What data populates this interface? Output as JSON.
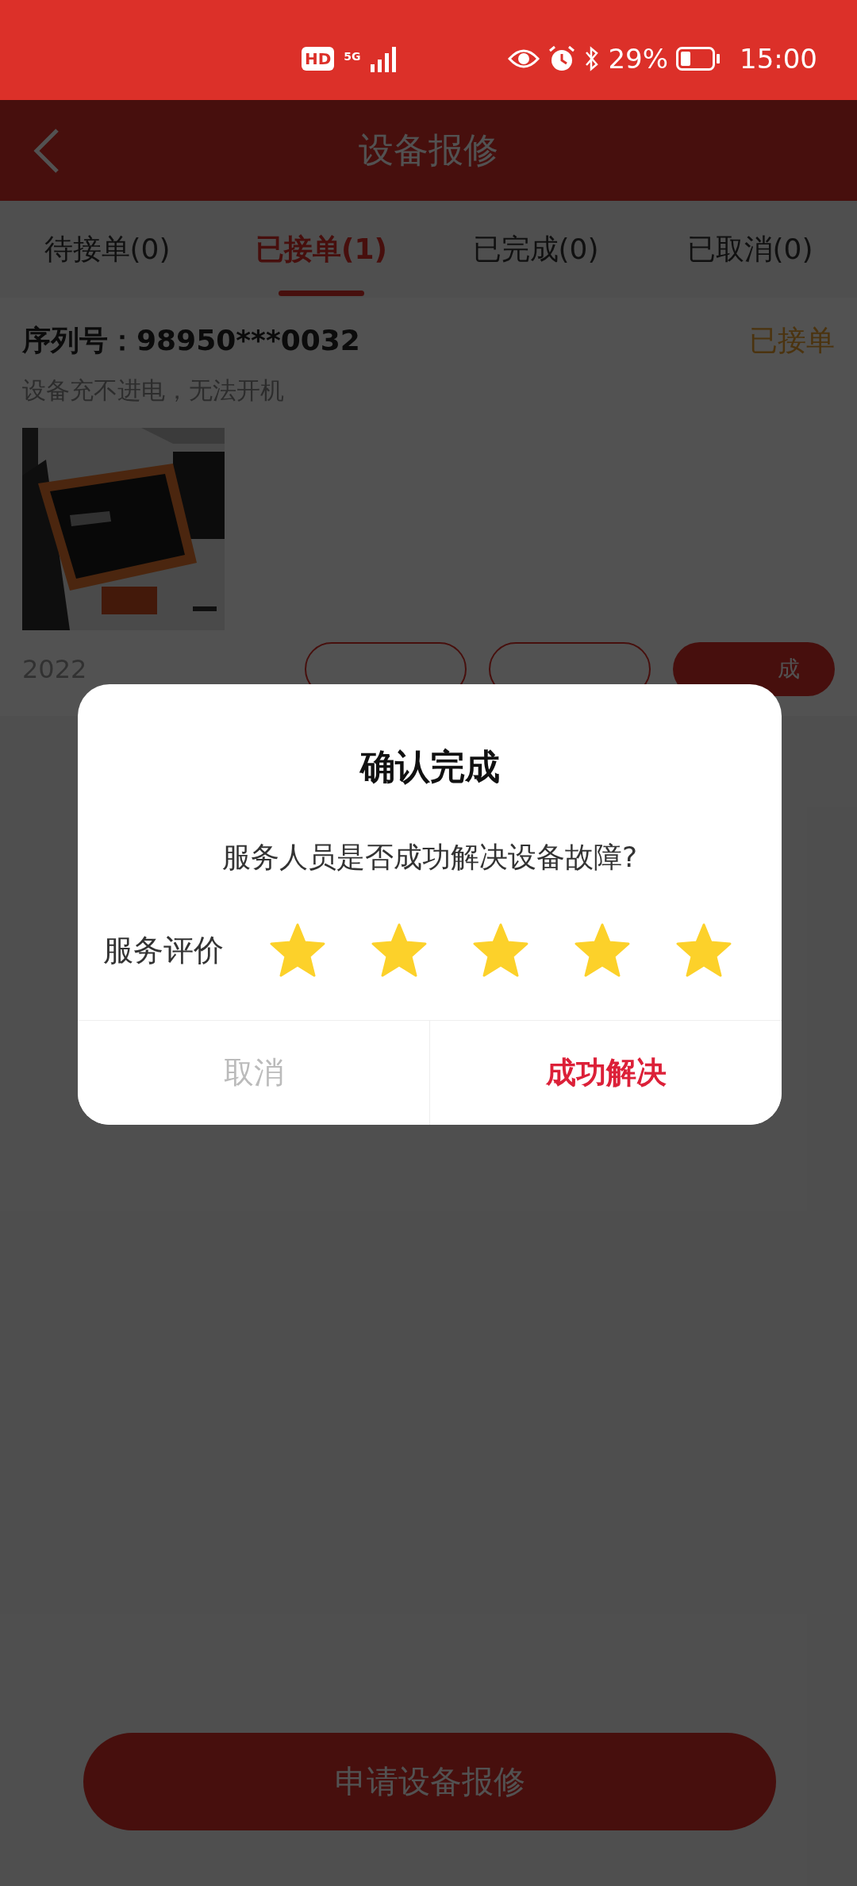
{
  "status_bar": {
    "hd": "HD",
    "network": "5G",
    "battery": "29%",
    "time": "15:00"
  },
  "header": {
    "title": "设备报修"
  },
  "tabs": [
    {
      "label": "待接单(0)",
      "selected": false
    },
    {
      "label": "已接单(1)",
      "selected": true
    },
    {
      "label": "已完成(0)",
      "selected": false
    },
    {
      "label": "已取消(0)",
      "selected": false
    }
  ],
  "order": {
    "serial_label": "序列号：",
    "serial": "98950***0032",
    "status": "已接单",
    "description": "设备充不进电，无法开机",
    "date": "2022",
    "actions": [
      {
        "kind": "outline"
      },
      {
        "kind": "outline"
      },
      {
        "label": "成",
        "kind": "filled"
      }
    ]
  },
  "dialog": {
    "title": "确认完成",
    "question": "服务人员是否成功解决设备故障?",
    "rating": {
      "label": "服务评价",
      "stars": 5
    },
    "buttons": [
      {
        "label": "取消",
        "kind": "cancel"
      },
      {
        "label": "成功解决",
        "kind": "confirm"
      }
    ]
  },
  "footer_button": "申请设备报修"
}
